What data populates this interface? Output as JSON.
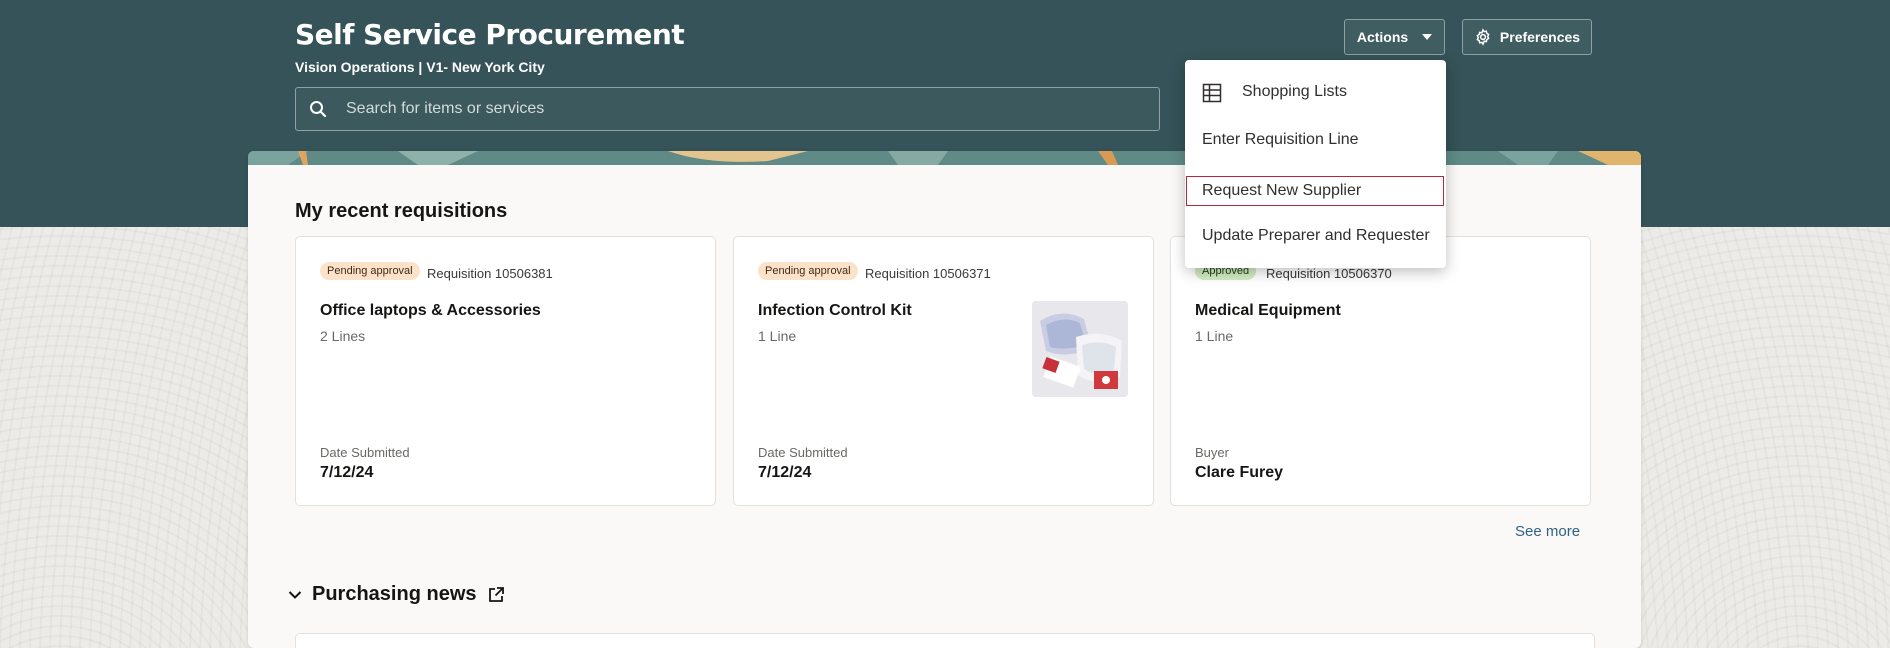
{
  "header": {
    "title": "Self Service Procurement",
    "subtitle": "Vision Operations | V1- New York City",
    "search_placeholder": "Search for items or services",
    "actions_label": "Actions",
    "preferences_label": "Preferences"
  },
  "actions_menu": {
    "items": [
      {
        "label": "Shopping Lists",
        "icon": "table-icon"
      },
      {
        "label": "Enter Requisition Line"
      },
      {
        "label": "Request New Supplier",
        "focused": true
      },
      {
        "label": "Update Preparer and Requester"
      }
    ]
  },
  "recent": {
    "title": "My recent requisitions",
    "cards": [
      {
        "status": "Pending approval",
        "requisition": "Requisition 10506381",
        "title": "Office laptops & Accessories",
        "lines": "2 Lines",
        "meta_label": "Date Submitted",
        "meta_value": "7/12/24"
      },
      {
        "status": "Pending approval",
        "requisition": "Requisition 10506371",
        "title": "Infection Control Kit",
        "lines": "1 Line",
        "meta_label": "Date Submitted",
        "meta_value": "7/12/24"
      },
      {
        "status": "Approved",
        "requisition": "Requisition 10506370",
        "title": "Medical Equipment",
        "lines": "1 Line",
        "meta_label": "Buyer",
        "meta_value": "Clare Furey"
      }
    ],
    "see_more": "See more"
  },
  "news": {
    "title": "Purchasing news"
  },
  "colors": {
    "header_bg": "#355358",
    "page_bg": "#f1efed",
    "link": "#2e6387",
    "pending_badge": "#fce2c8",
    "approved_badge": "#d2ecc4",
    "focus_outline": "#b5283c"
  }
}
